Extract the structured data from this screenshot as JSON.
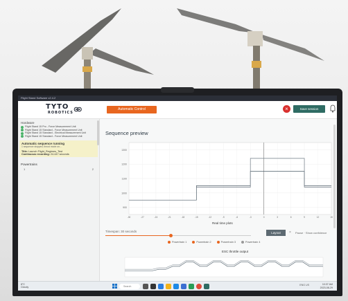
{
  "app": {
    "window_title": "Flight Stand Software v2.4.2"
  },
  "header": {
    "logo_text": "TYTO",
    "logo_sub": "ROBOTICS",
    "mode_button": "Automatic Control",
    "save_button": "Save session"
  },
  "sidebar": {
    "hardware_title": "Hardware",
    "hardware_items": [
      "Flight Stand 15 Pro - Force Measurement Unit",
      "Flight Stand 15 Standard - Force Measurement Unit",
      "Flight Stand 15 Standard - Electrical Measurement Unit",
      "Flight Stand 15 Standard - Force Measurement Unit"
    ],
    "sequence": {
      "title": "Automatic sequence running",
      "subtitle": "1 sequence stopped, thrust mode on...",
      "file_label": "Title:",
      "file_value": "Launch Flight_Regimes_Test",
      "recording_label": "Continuous recording:",
      "recording_value": "24.447 seconds"
    },
    "powertrains_label": "Powertrains",
    "powertrains_values": [
      "1",
      "2"
    ]
  },
  "main": {
    "section_title": "Sequence preview",
    "x_axis_label": "Real time plots",
    "timespan_label": "Timespan: 30 seconds",
    "timespan_fraction": 0.45,
    "layout_button": "Layout",
    "tools_text": "Pause  ·  Show confidence",
    "legend": [
      "Powertrain 1",
      "Powertrain 2",
      "Powertrain 3",
      "Powertrain 4"
    ],
    "esc_title": "ESC throttle output"
  },
  "taskbar": {
    "weather": "8°C",
    "weather_sub": "Cloudy",
    "search": "Search",
    "tray": "ENG US",
    "time": "10:37 AM",
    "date": "2023-08-29"
  },
  "colors": {
    "accent": "#e8661f",
    "save": "#2e6b63",
    "close": "#d9302e",
    "status_ok": "#4bb36a"
  },
  "chart_data": [
    {
      "type": "line",
      "title": "Sequence preview",
      "xlabel": "Real time plots",
      "ylabel": "",
      "x_ticks": [
        "-30",
        "-27",
        "-24",
        "-21",
        "-18",
        "-15",
        "-12",
        "-9",
        "-6",
        "-3",
        "0",
        "3",
        "6",
        "9",
        "12",
        "15"
      ],
      "y_ticks": [
        "1300",
        "1200",
        "1100",
        "1000",
        "900"
      ],
      "series": [
        {
          "points": [
            [
              -30,
              950
            ],
            [
              -15,
              950
            ],
            [
              -15,
              1050
            ],
            [
              -3,
              1050
            ],
            [
              -3,
              1150
            ],
            [
              9,
              1150
            ],
            [
              9,
              1050
            ],
            [
              15,
              1050
            ]
          ]
        },
        {
          "points": [
            [
              -15,
              1040
            ],
            [
              -3,
              1040
            ],
            [
              -3,
              1240
            ],
            [
              9,
              1240
            ],
            [
              9,
              1040
            ],
            [
              15,
              1040
            ]
          ]
        }
      ]
    },
    {
      "type": "line",
      "title": "ESC throttle output",
      "xlabel": "",
      "ylabel": "",
      "series": [
        {
          "values": [
            1150,
            1150,
            1150,
            1150,
            1150,
            1160,
            1160,
            1180,
            1180,
            1210,
            1210,
            1180,
            1180,
            1210,
            1210,
            1180,
            1180,
            1210,
            1210,
            1180,
            1180,
            1210,
            1210,
            1180,
            1180,
            1210,
            1210,
            1180,
            1180,
            1180
          ]
        },
        {
          "values": [
            1160,
            1160,
            1160,
            1160,
            1160,
            1170,
            1170,
            1190,
            1190,
            1220,
            1220,
            1190,
            1190,
            1220,
            1220,
            1190,
            1190,
            1220,
            1220,
            1190,
            1190,
            1220,
            1220,
            1190,
            1190,
            1220,
            1220,
            1190,
            1190,
            1190
          ]
        }
      ]
    }
  ]
}
